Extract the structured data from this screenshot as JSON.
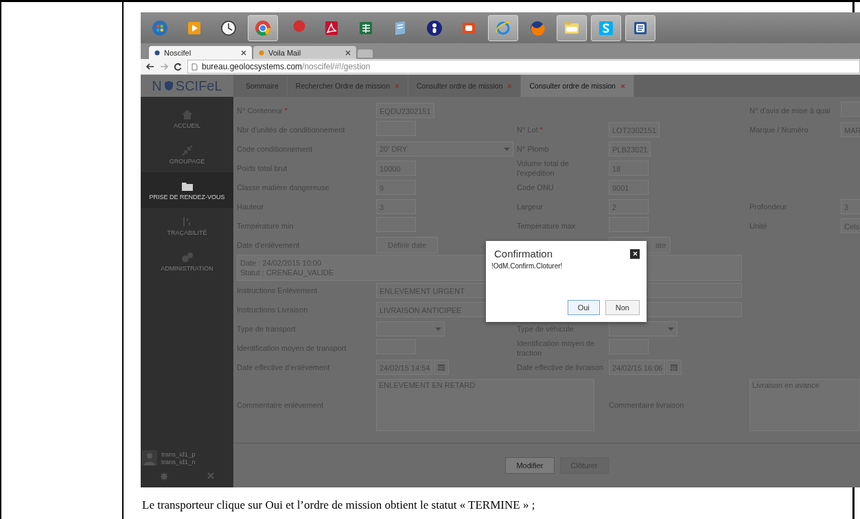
{
  "taskbar": {
    "items": [
      {
        "running": false
      },
      {
        "running": false
      },
      {
        "running": false
      },
      {
        "running": true
      },
      {
        "running": false
      },
      {
        "running": false
      },
      {
        "running": false
      },
      {
        "running": false
      },
      {
        "running": false
      },
      {
        "running": false
      },
      {
        "running": true
      },
      {
        "running": false
      },
      {
        "running": true
      },
      {
        "running": true
      },
      {
        "running": true
      }
    ]
  },
  "browser": {
    "tabs": [
      {
        "label": "Noscifel",
        "selected": true
      },
      {
        "label": "Voila Mail",
        "selected": false
      }
    ],
    "address": {
      "domain": "bureau.geolocsystems.com",
      "path": "/noscifel/#!/gestion"
    }
  },
  "app": {
    "logo_left": "N",
    "logo_right": "SCIFeL",
    "tabs": [
      {
        "label": "Sommaire",
        "closable": false,
        "selected": false
      },
      {
        "label": "Rechercher Ordre de mission",
        "closable": true,
        "selected": false
      },
      {
        "label": "Consulter ordre de mission",
        "closable": true,
        "selected": false
      },
      {
        "label": "Consulter ordre de mission",
        "closable": true,
        "selected": true
      }
    ],
    "sidebar": {
      "items": [
        {
          "label": "ACCUEIL",
          "selected": false
        },
        {
          "label": "GROUPAGE",
          "selected": false
        },
        {
          "label": "PRISE DE RENDEZ-VOUS",
          "selected": true
        },
        {
          "label": "TRAÇABILITÉ",
          "selected": false
        },
        {
          "label": "ADMINISTRATION",
          "selected": false
        }
      ],
      "user": {
        "lines": [
          "trans_id1_p",
          "trans_id1_n"
        ]
      }
    },
    "form": {
      "rows": [
        {
          "fields": [
            {
              "kind": "text",
              "label": "N° Conteneur",
              "required_mark": "*",
              "value": "EQDU2302151"
            },
            {
              "kind": "empty"
            },
            {
              "kind": "text",
              "label": "N° d'avis de mise à quai"
            }
          ]
        },
        {
          "fields": [
            {
              "kind": "text",
              "label": "Nbr d'unités de conditionnement"
            },
            {
              "kind": "text",
              "label": "N° Lot",
              "required_mark": "*",
              "value": "LOT2302151"
            },
            {
              "kind": "text",
              "label": "Marque / Numéro",
              "value": "MAR"
            }
          ]
        },
        {
          "fields": [
            {
              "kind": "select",
              "label": "Code conditionnement",
              "value": "20' DRY"
            },
            {
              "kind": "text",
              "label": "N° Plomb",
              "value": "PLB23021"
            },
            {
              "kind": "empty"
            }
          ]
        },
        {
          "fields": [
            {
              "kind": "text",
              "label": "Poids total brut",
              "value": "10000"
            },
            {
              "kind": "text",
              "label": "Volume total de l'expédition",
              "value": "18"
            },
            {
              "kind": "empty"
            }
          ]
        },
        {
          "fields": [
            {
              "kind": "text",
              "label": "Classe matière dangereuse",
              "value": "9"
            },
            {
              "kind": "text",
              "label": "Code ONU",
              "value": "9001"
            },
            {
              "kind": "empty"
            }
          ]
        },
        {
          "fields": [
            {
              "kind": "text",
              "label": "Hauteur",
              "value": "3"
            },
            {
              "kind": "text",
              "label": "Largeur",
              "value": "2"
            },
            {
              "kind": "text",
              "label": "Profondeur",
              "value": "3"
            }
          ]
        },
        {
          "fields": [
            {
              "kind": "text",
              "label": "Température min"
            },
            {
              "kind": "text",
              "label": "Température max"
            },
            {
              "kind": "text",
              "label": "Unité",
              "value": "Cels"
            }
          ]
        },
        {
          "fields": [
            {
              "kind": "button",
              "label": "Date d'enlèvement",
              "value": "Définir date"
            },
            {
              "kind": "button",
              "value": "ate"
            },
            {
              "kind": "empty"
            }
          ]
        },
        {
          "fields": [
            {
              "kind": "info",
              "lines": [
                "Date : 24/02/2015 10:00",
                "Statut : CRENEAU_VALIDE"
              ]
            }
          ]
        },
        {
          "fields": [
            {
              "kind": "wide",
              "label": "Instructions Enlèvement",
              "value": "ENLEVEMENT URGENT"
            }
          ]
        },
        {
          "fields": [
            {
              "kind": "wide",
              "label": "Instructions Livraison",
              "value": "LIVRAISON ANTICIPEE"
            }
          ]
        },
        {
          "fields": [
            {
              "kind": "select",
              "label": "Type de transport"
            },
            {
              "kind": "select",
              "label": "Type de véhicule"
            }
          ]
        },
        {
          "fields": [
            {
              "kind": "text",
              "label": "Identification moyen de transport"
            },
            {
              "kind": "text",
              "label": "Identification moyen de traction"
            }
          ]
        },
        {
          "fields": [
            {
              "kind": "date",
              "label": "Date effective d'enlèvement",
              "value": "24/02/15 14:54"
            },
            {
              "kind": "date",
              "label": "Date effective de livraison",
              "value": "24/02/15 16:06"
            }
          ]
        },
        {
          "fields": [
            {
              "kind": "textarea",
              "label": "Commentaire enlèvement",
              "value": "ENLEVEMENT EN RETARD"
            },
            {
              "kind": "textarea",
              "label": "Commentaire livraison",
              "value": "Livraison en avance"
            }
          ]
        }
      ]
    },
    "footer": {
      "buttons": [
        {
          "label": "Modifier",
          "disabled": false
        },
        {
          "label": "Clôturer",
          "disabled": true
        }
      ]
    },
    "modal": {
      "title": "Confirmation",
      "message": "!OdM.Confirm.Cloturer!",
      "buttons": [
        {
          "label": "Oui",
          "focused": true
        },
        {
          "label": "Non",
          "focused": false
        }
      ]
    }
  },
  "caption": "Le transporteur clique sur Oui et l’ordre de mission obtient le statut « TERMINE » ;"
}
